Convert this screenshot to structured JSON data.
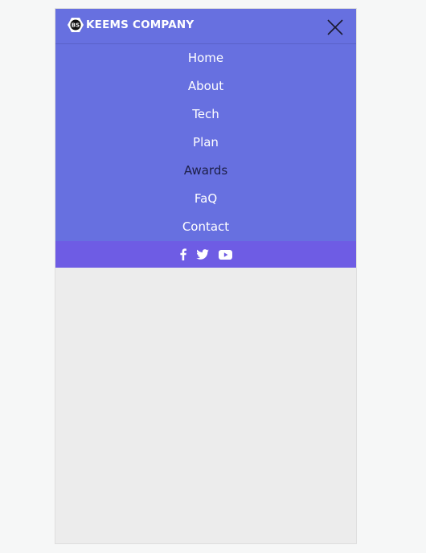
{
  "brand": {
    "badge_text": "BS",
    "name": "KEEMS COMPANY"
  },
  "menu": {
    "items": [
      {
        "label": "Home",
        "active": false
      },
      {
        "label": "About",
        "active": false
      },
      {
        "label": "Tech",
        "active": false
      },
      {
        "label": "Plan",
        "active": false
      },
      {
        "label": "Awards",
        "active": true
      },
      {
        "label": "FaQ",
        "active": false
      },
      {
        "label": "Contact",
        "active": false
      }
    ]
  },
  "social": {
    "icons": [
      "facebook-icon",
      "twitter-icon",
      "youtube-icon"
    ]
  },
  "colors": {
    "menu_bg": "#6770e0",
    "social_bar_bg": "#6e5ce4",
    "active_item": "#1d1f47",
    "page_bg": "#ececec"
  }
}
